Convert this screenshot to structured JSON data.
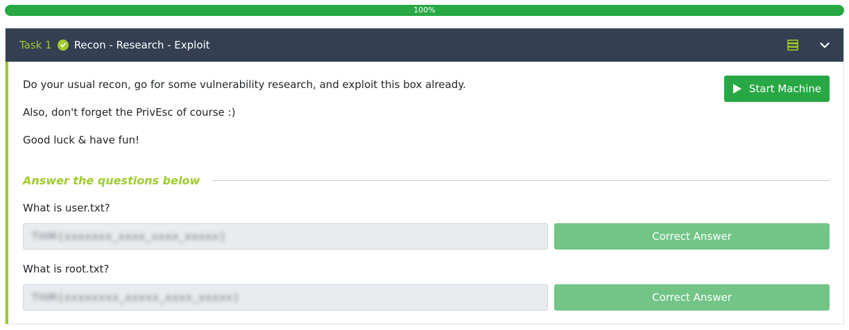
{
  "progress": {
    "label": "100%",
    "value": 1.0
  },
  "task": {
    "number_label": "Task 1",
    "title": "Recon - Research - Exploit",
    "completed": true,
    "description": [
      "Do your usual recon, go for some vulnerability research, and exploit this box already.",
      "Also, don't forget the PrivEsc of course :)",
      "Good luck & have fun!"
    ],
    "start_button_label": "Start Machine",
    "answers_heading": "Answer the questions below",
    "questions": [
      {
        "question": "What is user.txt?",
        "answer_value": "THM{xxxxxxx_xxxx_xxxx_xxxxx}",
        "button_label": "Correct Answer"
      },
      {
        "question": "What is root.txt?",
        "answer_value": "THM{xxxxxxxx_xxxxx_xxxx_xxxxx}",
        "button_label": "Correct Answer"
      }
    ]
  },
  "icons": {
    "check": "check-circle-icon",
    "server": "server-icon",
    "chevron": "chevron-down-icon",
    "play": "play-icon"
  },
  "colors": {
    "accent_green": "#9fcb2e",
    "header_bg": "#343f52",
    "button_green": "#27a844",
    "correct_answer_green": "#72c586"
  }
}
